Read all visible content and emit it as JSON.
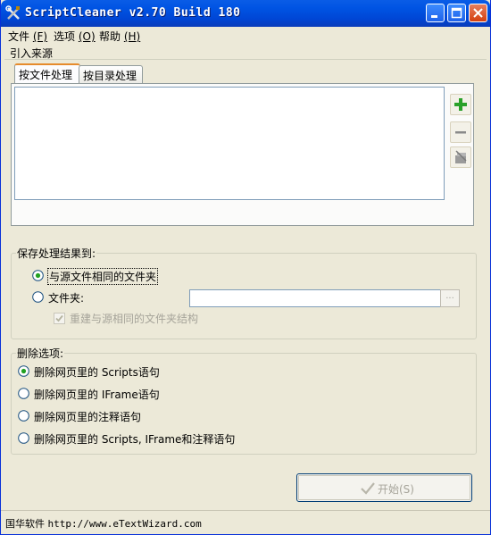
{
  "window": {
    "title": "ScriptCleaner  v2.70 Build 180"
  },
  "menu": [
    {
      "label": "文件",
      "mnemonic": "(F)"
    },
    {
      "label": "选项",
      "mnemonic": "(O)"
    },
    {
      "label": "帮助",
      "mnemonic": "(H)"
    }
  ],
  "source": {
    "title": "引入来源",
    "tabs": [
      {
        "label": "按文件处理",
        "active": true
      },
      {
        "label": "按目录处理",
        "active": false
      }
    ]
  },
  "save": {
    "title": "保存处理结果到:",
    "option_same": "与源文件相同的文件夹",
    "option_folder": "文件夹:",
    "folder_value": "",
    "browse_label": "...",
    "rebuild_label": "重建与源相同的文件夹结构",
    "selected": "same",
    "rebuild_checked": true
  },
  "delete": {
    "title": "删除选项:",
    "options": [
      "删除网页里的 Scripts语句",
      "删除网页里的 IFrame语句",
      "删除网页里的注释语句",
      "删除网页里的 Scripts, IFrame和注释语句"
    ],
    "selected_index": 0
  },
  "start": {
    "label": "开始(S)"
  },
  "status": {
    "company": "国华软件",
    "url": "http://www.eTextWizard.com"
  },
  "colors": {
    "titlebar": "#0054e3",
    "window_bg": "#ece9d8",
    "add_green": "#2aa12a",
    "remove_gray": "#8a8a8a"
  },
  "icons": {
    "app": "tools-icon",
    "add": "plus-icon",
    "remove": "minus-icon",
    "clear": "clear-list-icon",
    "start": "checkmark-icon"
  }
}
